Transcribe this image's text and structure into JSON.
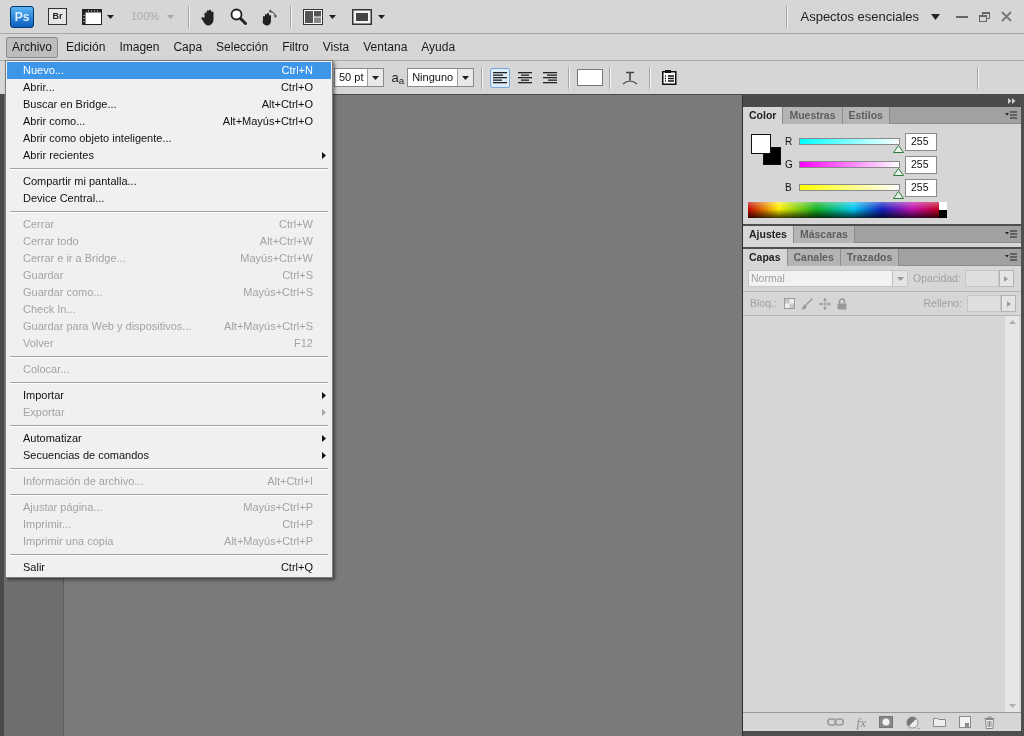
{
  "app_bar": {
    "logo": "Ps",
    "bridge_button": "Br",
    "zoom_level": {
      "value": "100%",
      "disabled": true
    },
    "workspace": "Aspectos esenciales"
  },
  "menu_bar": [
    {
      "label": "Archivo",
      "selected": true
    },
    {
      "label": "Edición",
      "selected": false
    },
    {
      "label": "Imagen",
      "selected": false
    },
    {
      "label": "Capa",
      "selected": false
    },
    {
      "label": "Selección",
      "selected": false
    },
    {
      "label": "Filtro",
      "selected": false
    },
    {
      "label": "Vista",
      "selected": false
    },
    {
      "label": "Ventana",
      "selected": false
    },
    {
      "label": "Ayuda",
      "selected": false
    }
  ],
  "file_menu": {
    "items": [
      {
        "kind": "item",
        "label": "Nuevo...",
        "shortcut": "Ctrl+N",
        "selected": true,
        "disabled": false
      },
      {
        "kind": "item",
        "label": "Abrir...",
        "shortcut": "Ctrl+O",
        "selected": false,
        "disabled": false
      },
      {
        "kind": "item",
        "label": "Buscar en Bridge...",
        "shortcut": "Alt+Ctrl+O",
        "selected": false,
        "disabled": false
      },
      {
        "kind": "item",
        "label": "Abrir como...",
        "shortcut": "Alt+Mayús+Ctrl+O",
        "selected": false,
        "disabled": false
      },
      {
        "kind": "item",
        "label": "Abrir como objeto inteligente...",
        "selected": false,
        "disabled": false
      },
      {
        "kind": "submenu",
        "label": "Abrir recientes",
        "selected": false,
        "disabled": false
      },
      {
        "kind": "separator"
      },
      {
        "kind": "item",
        "label": "Compartir mi pantalla...",
        "selected": false,
        "disabled": false
      },
      {
        "kind": "item",
        "label": "Device Central...",
        "selected": false,
        "disabled": false
      },
      {
        "kind": "separator"
      },
      {
        "kind": "item",
        "label": "Cerrar",
        "shortcut": "Ctrl+W",
        "selected": false,
        "disabled": true
      },
      {
        "kind": "item",
        "label": "Cerrar todo",
        "shortcut": "Alt+Ctrl+W",
        "selected": false,
        "disabled": true
      },
      {
        "kind": "item",
        "label": "Cerrar e ir a Bridge...",
        "shortcut": "Mayús+Ctrl+W",
        "selected": false,
        "disabled": true
      },
      {
        "kind": "item",
        "label": "Guardar",
        "shortcut": "Ctrl+S",
        "selected": false,
        "disabled": true
      },
      {
        "kind": "item",
        "label": "Guardar como...",
        "shortcut": "Mayús+Ctrl+S",
        "selected": false,
        "disabled": true
      },
      {
        "kind": "item",
        "label": "Check In...",
        "selected": false,
        "disabled": true
      },
      {
        "kind": "item",
        "label": "Guardar para Web y dispositivos...",
        "shortcut": "Alt+Mayús+Ctrl+S",
        "selected": false,
        "disabled": true
      },
      {
        "kind": "item",
        "label": "Volver",
        "shortcut": "F12",
        "selected": false,
        "disabled": true
      },
      {
        "kind": "separator"
      },
      {
        "kind": "item",
        "label": "Colocar...",
        "selected": false,
        "disabled": true
      },
      {
        "kind": "separator"
      },
      {
        "kind": "submenu",
        "label": "Importar",
        "selected": false,
        "disabled": false
      },
      {
        "kind": "submenu",
        "label": "Exportar",
        "selected": false,
        "disabled": true
      },
      {
        "kind": "separator"
      },
      {
        "kind": "submenu",
        "label": "Automatizar",
        "selected": false,
        "disabled": false
      },
      {
        "kind": "submenu",
        "label": "Secuencias de comandos",
        "selected": false,
        "disabled": false
      },
      {
        "kind": "separator"
      },
      {
        "kind": "item",
        "label": "Información de archivo...",
        "shortcut": "Alt+Ctrl+I",
        "selected": false,
        "disabled": true
      },
      {
        "kind": "separator"
      },
      {
        "kind": "item",
        "label": "Ajustar página...",
        "shortcut": "Mayús+Ctrl+P",
        "selected": false,
        "disabled": true
      },
      {
        "kind": "item",
        "label": "Imprimir...",
        "shortcut": "Ctrl+P",
        "selected": false,
        "disabled": true
      },
      {
        "kind": "item",
        "label": "Imprimir una copia",
        "shortcut": "Alt+Mayús+Ctrl+P",
        "selected": false,
        "disabled": true
      },
      {
        "kind": "separator"
      },
      {
        "kind": "item",
        "label": "Salir",
        "shortcut": "Ctrl+Q",
        "selected": false,
        "disabled": false
      }
    ]
  },
  "options_bar": {
    "font_size": "50 pt",
    "antialias_icon": "a$_{a}$",
    "antialias": "Ninguno",
    "align_buttons": [
      {
        "kind": "left",
        "selected": true
      },
      {
        "kind": "center",
        "selected": false
      },
      {
        "kind": "right",
        "selected": false
      }
    ],
    "text_color_swatch": {
      "color": "#ffffff"
    }
  },
  "color_panel": {
    "tabs": [
      {
        "label": "Color",
        "selected": true
      },
      {
        "label": "Muestras",
        "selected": false
      },
      {
        "label": "Estilos",
        "selected": false
      }
    ],
    "swatches": [
      {
        "kind": "foreground",
        "color": "#ffffff"
      },
      {
        "kind": "background",
        "color": "#000000"
      }
    ],
    "channels": [
      {
        "label": "R",
        "level": 1,
        "value": "255"
      },
      {
        "label": "G",
        "level": 1,
        "value": "255"
      },
      {
        "label": "B",
        "level": 1,
        "value": "255"
      }
    ]
  },
  "adjustments_panel": {
    "tabs": [
      {
        "label": "Ajustes",
        "selected": true
      },
      {
        "label": "Máscaras",
        "selected": false
      }
    ]
  },
  "layers_panel": {
    "tabs": [
      {
        "label": "Capas",
        "selected": true
      },
      {
        "label": "Canales",
        "selected": false
      },
      {
        "label": "Trazados",
        "selected": false
      }
    ],
    "disabled": true,
    "blend_mode": "Normal",
    "opacity_label": "Opacidad:",
    "lock_label": "Bloq.:",
    "fill_label": "Relleno:",
    "effects_button": "fx"
  }
}
